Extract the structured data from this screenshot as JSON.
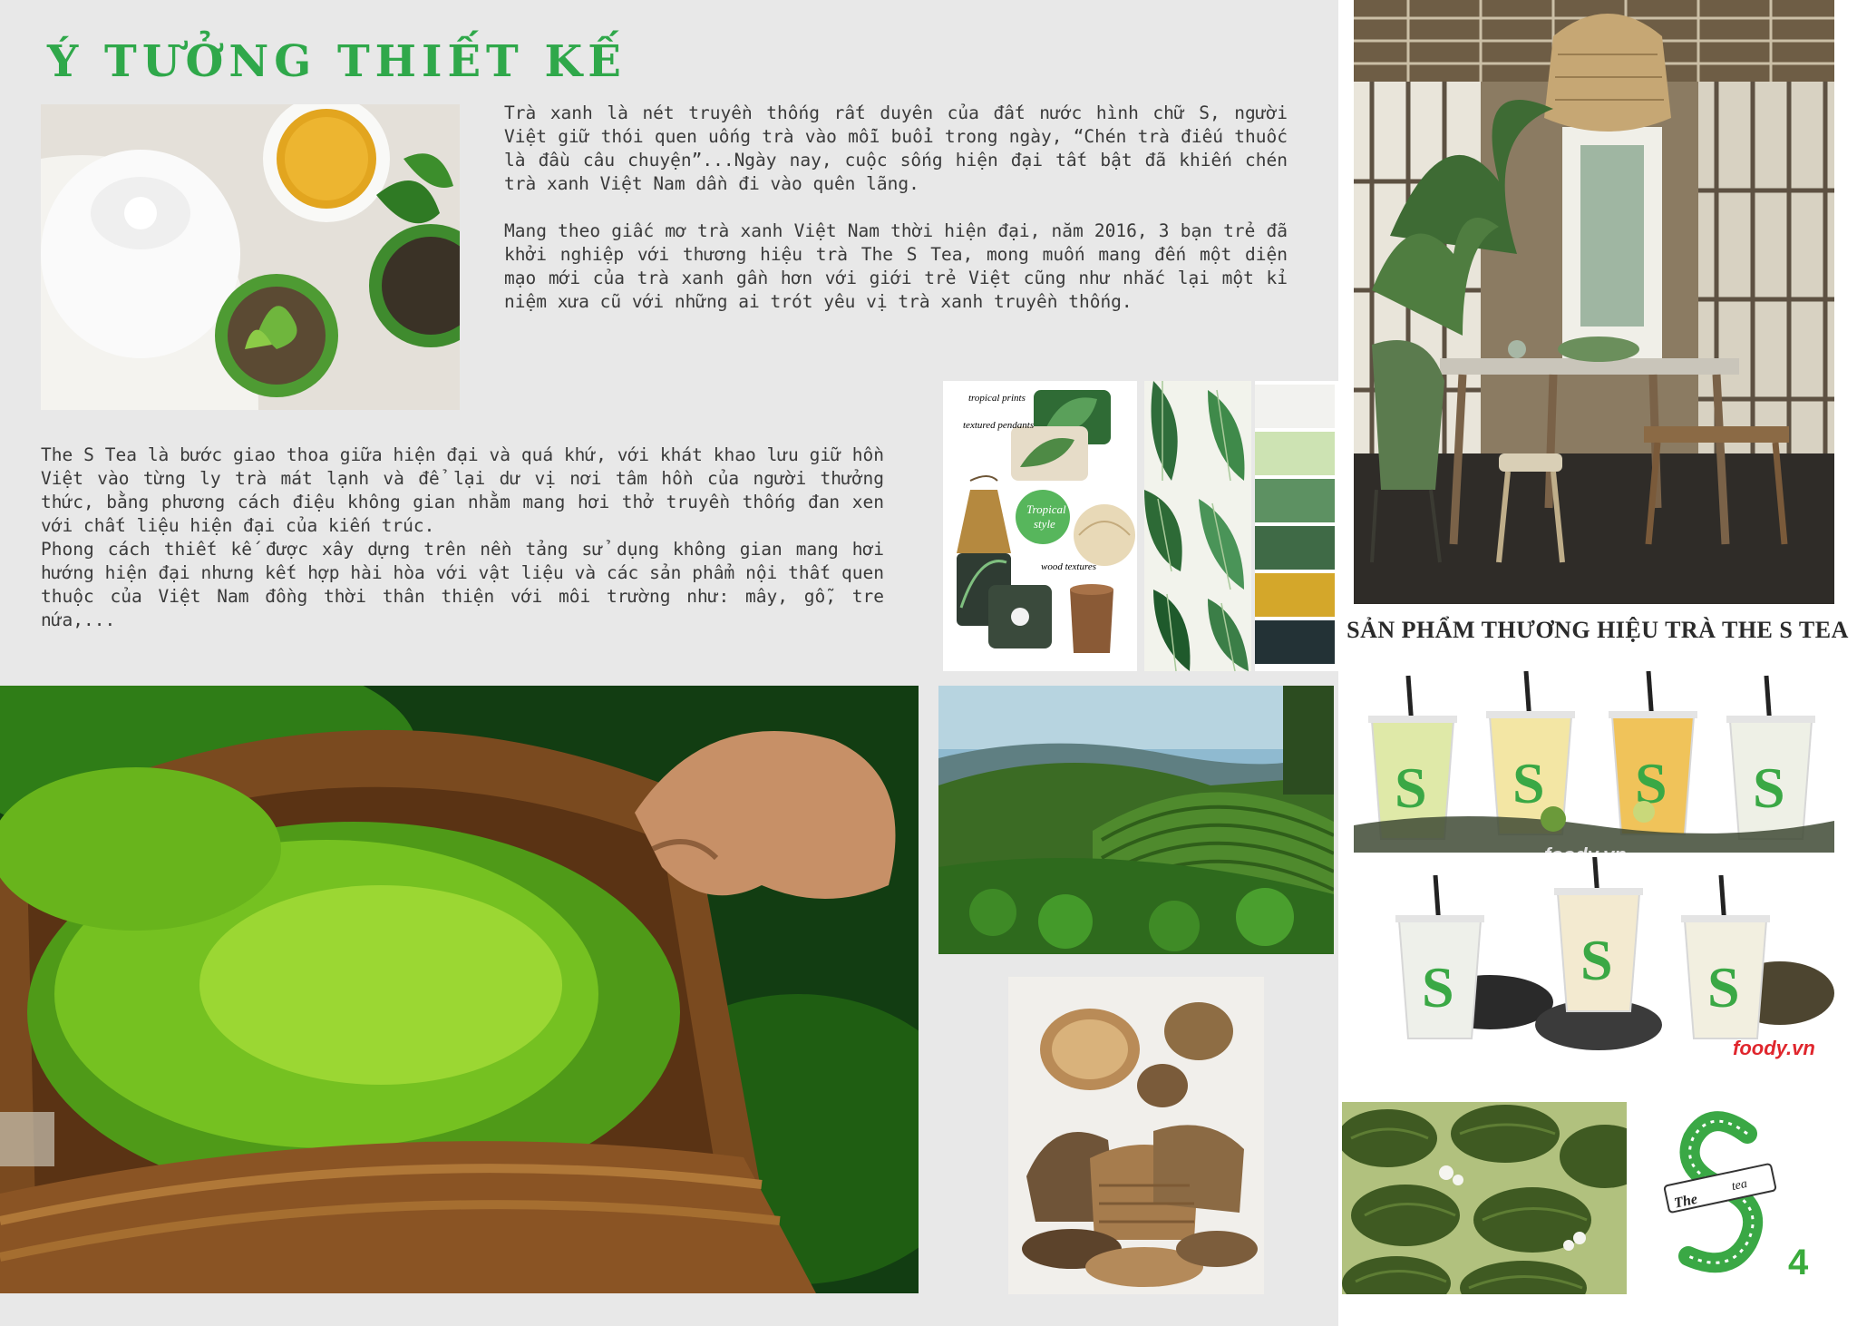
{
  "page": {
    "title": "Ý TƯỞNG THIẾT KẾ",
    "page_number": "4"
  },
  "intro": {
    "paragraph_1": "  Trà xanh là nét truyền thống rất duyên của đất nước hình chữ S, người Việt giữ thói quen uống trà vào mỗi buổi trong ngày, “Chén trà điếu thuốc là đầu câu chuyện”...Ngày nay, cuộc sống hiện đại tất bật đã khiến chén trà xanh Việt Nam dần đi vào quên lãng.\n\n  Mang theo giấc mơ trà xanh Việt Nam thời hiện đại, năm 2016, 3 bạn trẻ đã khởi nghiệp với thương hiệu trà The S Tea, mong muốn mang đến một diện mạo mới của trà xanh gần hơn với giới trẻ Việt cũng như nhắc lại một kỉ niệm xưa cũ với những ai trót yêu vị trà xanh truyền thống."
  },
  "concept": {
    "paragraph_2": "  The S Tea là bước giao thoa giữa hiện đại và quá khứ, với khát khao lưu giữ hồn Việt vào từng ly trà mát lạnh và để lại dư vị nơi tâm hồn của người thưởng thức, bằng phương cách điệu không gian nhằm mang hơi thở truyền thống đan xen với chất liệu hiện đại của kiến trúc.\n  Phong cách thiết kế được xây dựng trên nền tảng sử dụng không gian mang hơi hướng hiện đại nhưng kết hợp hài hòa với vật liệu và các sản phẩm nội thất quen thuộc của Việt Nam đồng thời thân thiện với môi trường như: mây, gỗ, tre nứa,..."
  },
  "moodboard": {
    "labels": [
      "tropical prints",
      "textured pendants",
      "wood textures"
    ],
    "badge": [
      "Tropical",
      "style"
    ]
  },
  "palette": [
    "#f2f2ef",
    "#cde3b3",
    "#5d9162",
    "#3f6a46",
    "#d4a72a",
    "#233236"
  ],
  "brand": {
    "section_title": "SẢN PHẨM THƯƠNG HIỆU TRÀ THE S TEA",
    "cup_mark": "S",
    "watermark": "foody.vn",
    "logo_text_1": "The",
    "logo_text_2": "tea"
  }
}
